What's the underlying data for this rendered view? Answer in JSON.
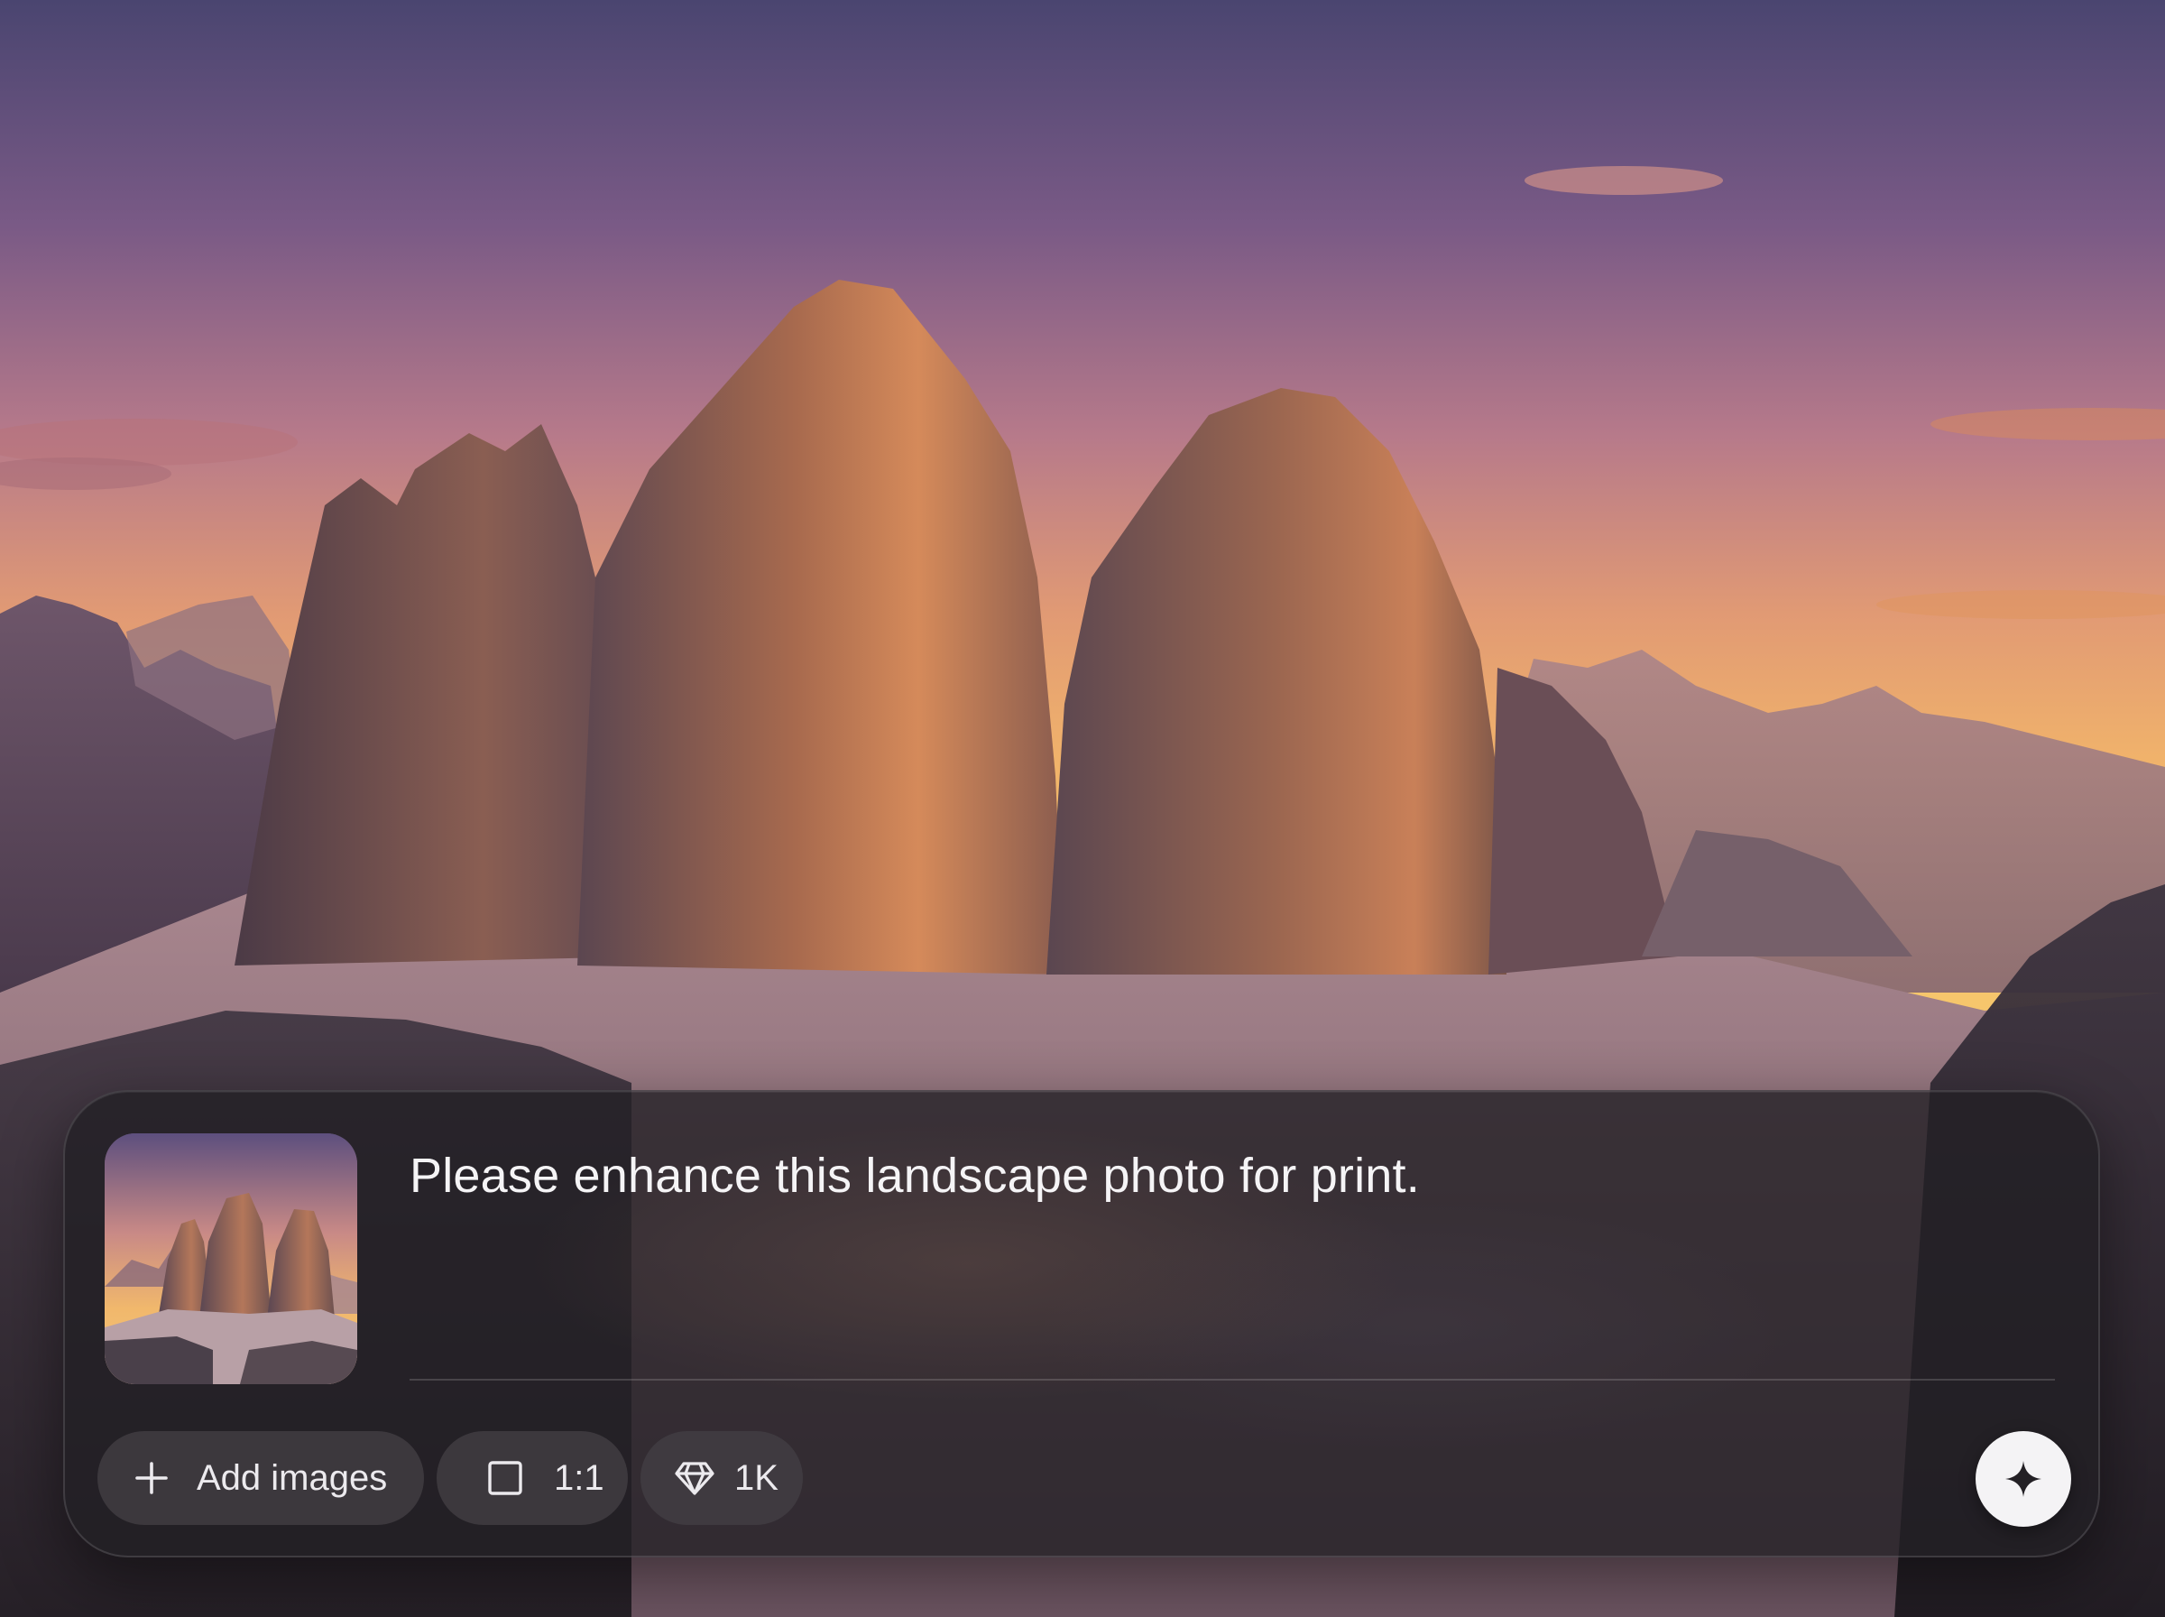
{
  "composer": {
    "prompt_text": "Please enhance this landscape photo for print.",
    "attachment_icon": "image-thumbnail",
    "toolbar": {
      "add_images_label": "Add images",
      "add_images_icon": "plus-icon",
      "aspect_ratio_label": "1:1",
      "aspect_ratio_icon": "square-icon",
      "resolution_label": "1K",
      "resolution_icon": "diamond-icon"
    },
    "send_icon": "sparkle-icon"
  },
  "colors": {
    "panel": "#221f24",
    "pill": "#423e44",
    "text": "#f5f4f6",
    "send_button": "#f4f3f5",
    "send_icon": "#232025"
  }
}
